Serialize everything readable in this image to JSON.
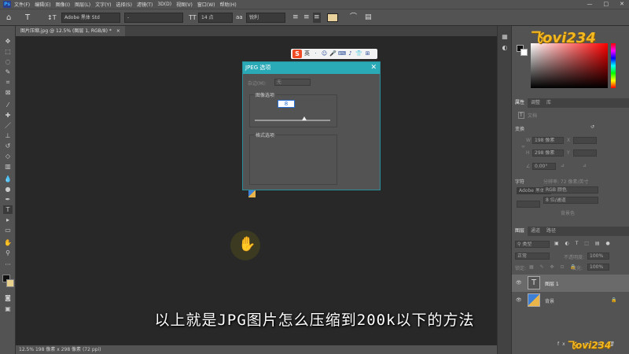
{
  "app": {
    "logo": "Ps"
  },
  "menu": [
    "文件(F)",
    "编辑(E)",
    "图像(I)",
    "图层(L)",
    "文字(Y)",
    "选择(S)",
    "滤镜(T)",
    "3D(D)",
    "视图(V)",
    "窗口(W)",
    "帮助(H)"
  ],
  "window_controls": {
    "minimize": "—",
    "maximize": "□",
    "close": "✕"
  },
  "options": {
    "font_family": "Adobe 黑体 Std",
    "font_style": "-",
    "font_size": "14 点",
    "antialias_label": "aa",
    "antialias": "锐利"
  },
  "tab": {
    "title": "图片压缩.jpg @ 12.5% (图层 1, RGB/8) *",
    "close": "×"
  },
  "status": {
    "text": "12.5%    198 像素 x 298 像素 (72 ppi)"
  },
  "dialog": {
    "title": "JPEG 选项",
    "close": "✕",
    "matte_label": "杂边(M):",
    "matte_value": "无",
    "image_options_label": "图像选项",
    "quality_value": "8",
    "format_options_label": "格式选项"
  },
  "ime": {
    "logo": "S",
    "lang": "英",
    "icons": [
      "·",
      "☺",
      "🎤",
      "⌨",
      "♪",
      "👕",
      "⊞"
    ]
  },
  "subtitle": "以上就是JPG图片怎么压缩到200k以下的方法",
  "watermark": {
    "top": "飞ovi234",
    "bottom": "飞ovi234"
  },
  "panels": {
    "properties_tabs": [
      "属性",
      "调整",
      "库"
    ],
    "doc_label": "文档",
    "transform_label": "变换",
    "w_label": "W",
    "w_value": "198 像素",
    "x_label": "X",
    "h_label": "H",
    "h_value": "298 像素",
    "y_label": "Y",
    "angle_value": "0.00°",
    "char_label": "字符",
    "resolution": "分辨率: 72 像素/英寸",
    "color_mode": "RGB 颜色",
    "bit_depth": "8 位/通道",
    "bg_label": "背景色",
    "font_row": "Adobe 黑体 Std",
    "layers_tabs": [
      "图层",
      "通道",
      "路径"
    ],
    "kind_label": "类型",
    "blend_mode": "正常",
    "opacity_label": "不透明度:",
    "opacity": "100%",
    "lock_label": "锁定:",
    "fill_label": "填充:",
    "fill": "100%",
    "layers": [
      {
        "name": "图层 1",
        "thumb": "T"
      },
      {
        "name": "背景",
        "thumb": ""
      }
    ]
  }
}
